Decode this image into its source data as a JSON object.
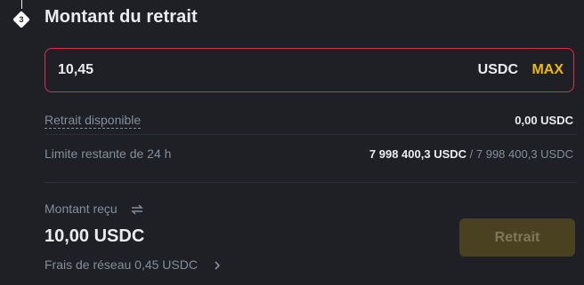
{
  "step": {
    "number": "3",
    "title": "Montant du retrait"
  },
  "amount_input": {
    "value": "10,45",
    "unit": "USDC",
    "max_label": "MAX"
  },
  "available": {
    "label": "Retrait disponible",
    "value": "0,00 USDC"
  },
  "limit": {
    "label": "Limite restante de 24 h",
    "remaining": "7 998 400,3 USDC",
    "separator": " / ",
    "total": "7 998 400,3 USDC"
  },
  "received": {
    "label": "Montant reçu",
    "amount": "10,00 USDC",
    "fee_text": "Frais de réseau 0,45 USDC"
  },
  "withdraw_button": {
    "label": "Retrait"
  },
  "icons": {
    "swap": "swap-arrows-icon",
    "chevron": "chevron-right-icon"
  },
  "colors": {
    "background": "#1e2026",
    "accent": "#f0b90b",
    "error_border": "#d9304e",
    "muted_text": "#848e9c",
    "disabled_button_bg": "#4a4121",
    "disabled_button_text": "#7e7657"
  }
}
